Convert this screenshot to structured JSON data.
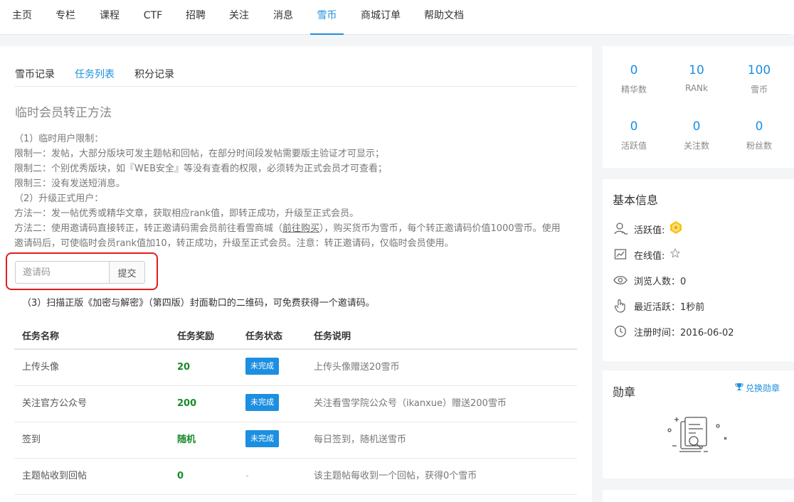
{
  "nav": {
    "items": [
      {
        "label": "主页"
      },
      {
        "label": "专栏"
      },
      {
        "label": "课程"
      },
      {
        "label": "CTF"
      },
      {
        "label": "招聘"
      },
      {
        "label": "关注"
      },
      {
        "label": "消息"
      },
      {
        "label": "雪币"
      },
      {
        "label": "商城订单"
      },
      {
        "label": "帮助文档"
      }
    ],
    "active": "雪币"
  },
  "tabs": [
    {
      "label": "雪币记录"
    },
    {
      "label": "任务列表"
    },
    {
      "label": "积分记录"
    }
  ],
  "active_tab": "任务列表",
  "section_title": "临时会员转正方法",
  "rules": {
    "line1": "（1）临时用户限制：",
    "line2": "限制一：发帖，大部分版块可发主题帖和回帖，在部分时间段发帖需要版主验证才可显示；",
    "line3": "限制二：个别优秀版块，如『WEB安全』等没有查看的权限，必须转为正式会员才可查看；",
    "line4": "限制三：没有发送短消息。",
    "line5": "（2）升级正式用户：",
    "line6": "方法一：发一帖优秀或精华文章，获取相应rank值，即转正成功，升级至正式会员。",
    "line7_pre": "方法二：使用邀请码直接转正，转正邀请码需会员前往看雪商城（",
    "line7_link": "前往购买",
    "line7_post": "），购买货币为雪币，每个转正邀请码价值1000雪币。使用邀请码后，可使临时会员rank值加10，转正成功，升级至正式会员。注意：转正邀请码，仅临时会员使用。"
  },
  "invite": {
    "placeholder": "邀请码",
    "value": "",
    "submit_label": "提交"
  },
  "scan_note": "（3）扫描正版《加密与解密》（第四版）封面勒口的二维码，可免费获得一个邀请码。",
  "task_table": {
    "columns": [
      "任务名称",
      "任务奖励",
      "任务状态",
      "任务说明"
    ],
    "rows": [
      {
        "name": "上传头像",
        "reward": "20",
        "status": "未完成",
        "desc": "上传头像赠送20雪币"
      },
      {
        "name": "关注官方公众号",
        "reward": "200",
        "status": "未完成",
        "desc": "关注看雪学院公众号（ikanxue）赠送200雪币"
      },
      {
        "name": "签到",
        "reward": "随机",
        "status": "未完成",
        "desc": "每日签到，随机送雪币"
      },
      {
        "name": "主题帖收到回帖",
        "reward": "0",
        "status": "-",
        "desc": "该主题帖每收到一个回帖，获得0个雪币"
      }
    ]
  },
  "stats": [
    {
      "value": "0",
      "label": "精华数"
    },
    {
      "value": "10",
      "label": "RANk"
    },
    {
      "value": "100",
      "label": "雪币"
    },
    {
      "value": "0",
      "label": "活跃值"
    },
    {
      "value": "0",
      "label": "关注数"
    },
    {
      "value": "0",
      "label": "粉丝数"
    }
  ],
  "basic_info": {
    "title": "基本信息",
    "activity_label": "活跃值:",
    "online_label": "在线值:",
    "views": "浏览人数：0",
    "last_active": "最近活跃：1秒前",
    "register": "注册时间：2016-06-02"
  },
  "medals": {
    "title": "勋章",
    "exchange_label": "兑换勋章"
  },
  "colors": {
    "accent": "#1c8fe0",
    "reward_green": "#178a28",
    "highlight_red": "#e11c1c"
  },
  "icons": {
    "activity": "user-wave-icon",
    "online": "chart-icon",
    "views": "eye-icon",
    "last_active": "hand-icon",
    "register": "clock-icon",
    "exchange": "trophy-icon"
  }
}
